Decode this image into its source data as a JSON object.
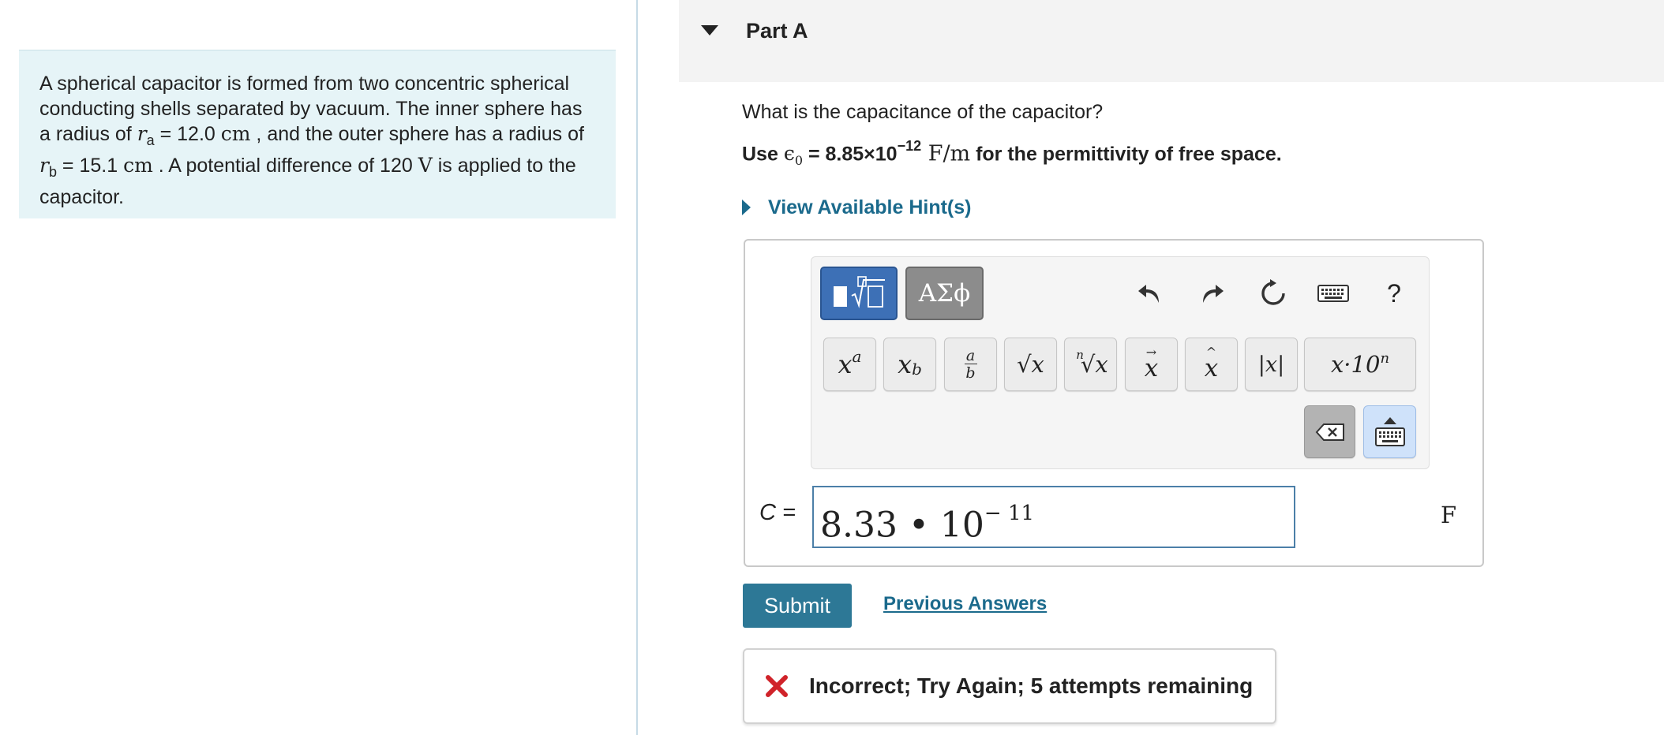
{
  "problem": {
    "text_1": "A spherical capacitor is formed from two concentric spherical conducting shells separated by vacuum. The inner sphere has a radius of ",
    "ra_symbol": "r",
    "ra_sub": "a",
    "ra_value": " = 12.0 ",
    "ra_unit": "cm",
    "text_2": " , and the outer sphere has a radius of ",
    "rb_symbol": "r",
    "rb_sub": "b",
    "rb_value": " = 15.1 ",
    "rb_unit": "cm",
    "text_3": " . A potential difference of 120 ",
    "v_unit": "V",
    "text_4": " is applied to the capacitor."
  },
  "part": {
    "title": "Part A",
    "question": "What is the capacitance of the capacitor?",
    "perm_use": "Use ",
    "perm_eps": "ϵ",
    "perm_eps_sub": "0",
    "perm_value": " = 8.85×10",
    "perm_exp": "−12",
    "perm_unit": " F/m",
    "perm_tail": " for the permittivity of free space.",
    "hint_label": "View Available Hint(s)"
  },
  "toolbar": {
    "mode_math": "templates-mode",
    "mode_greek": "ΑΣϕ",
    "icons": [
      "undo-icon",
      "redo-icon",
      "reset-icon",
      "keyboard-shortcuts-icon",
      "help-icon"
    ],
    "help_label": "?",
    "keys": {
      "superscript": "a",
      "subscript": "b",
      "fraction_num": "a",
      "fraction_den": "b",
      "sqrt": "√x",
      "nth_root_n": "n",
      "nth_root": "√x",
      "vector": "x",
      "unit_vector": "x",
      "abs": "|x|",
      "sci_notation": "x·10",
      "sci_exp": "n"
    }
  },
  "answer": {
    "label": "C =",
    "mantissa": "8.33 • 10",
    "exponent": "− 11",
    "unit": "F"
  },
  "actions": {
    "submit": "Submit",
    "previous_answers": "Previous Answers"
  },
  "feedback": {
    "text": "Incorrect; Try Again; 5 attempts remaining",
    "color": "#d0232a"
  },
  "colors": {
    "accent": "#2d7896",
    "link": "#1b6a8c",
    "problem_bg": "#e6f4f7"
  }
}
